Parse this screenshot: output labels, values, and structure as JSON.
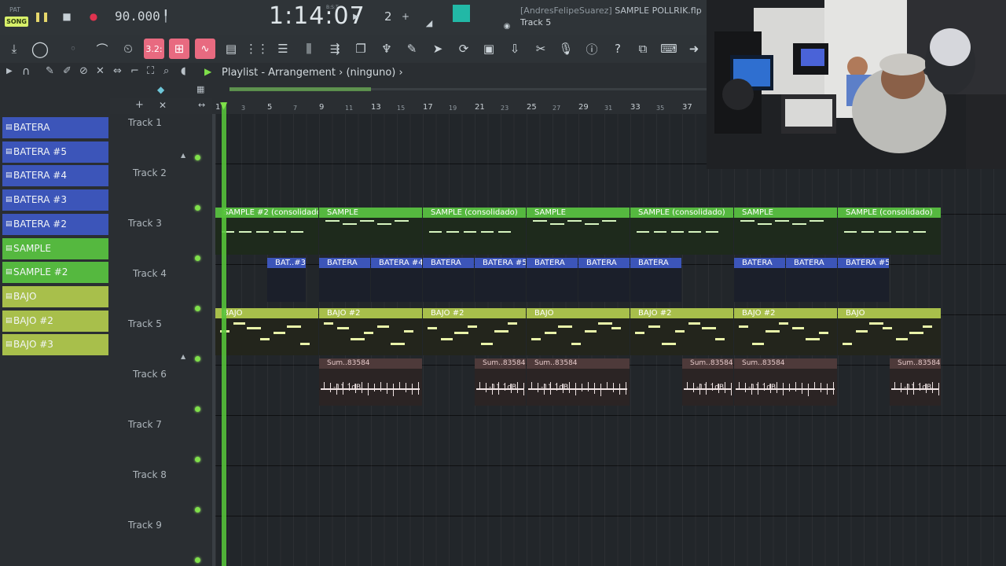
{
  "topbar": {
    "pat_label": "PAT",
    "song_label": "SONG",
    "tempo": "90.000",
    "time": "1:14:07",
    "bst_label": "B:S:T",
    "pattern_number": "2",
    "plus_label": "+",
    "file_user": "[AndresFelipeSuarez]",
    "file_name": "SAMPLE POLLRIK.flp",
    "current_track": "Track 5"
  },
  "toolbar": {
    "snap_value": "3.2:"
  },
  "playlist": {
    "title": "Playlist - Arrangement",
    "separator": "›",
    "pattern_selector": "(ninguno)"
  },
  "browser": {
    "patterns": [
      {
        "label": "BATERA",
        "color": "blue"
      },
      {
        "label": "BATERA #5",
        "color": "blue"
      },
      {
        "label": "BATERA #4",
        "color": "blue"
      },
      {
        "label": "BATERA #3",
        "color": "blue"
      },
      {
        "label": "BATERA #2",
        "color": "blue"
      },
      {
        "label": "SAMPLE",
        "color": "green"
      },
      {
        "label": "SAMPLE #2",
        "color": "green"
      },
      {
        "label": "BAJO",
        "color": "yellow"
      },
      {
        "label": "BAJO #2",
        "color": "yellow"
      },
      {
        "label": "BAJO #3",
        "color": "yellow"
      }
    ]
  },
  "tracks": [
    "Track 1",
    "Track 2",
    "Track 3",
    "Track 4",
    "Track 5",
    "Track 6",
    "Track 7",
    "Track 8",
    "Track 9"
  ],
  "ruler": {
    "major": [
      "1",
      "5",
      "9",
      "13",
      "17",
      "21",
      "25",
      "29",
      "33",
      "37"
    ],
    "minor": [
      "3",
      "7",
      "11",
      "15",
      "19",
      "23",
      "27",
      "31",
      "35"
    ]
  },
  "clips": {
    "track3": [
      "SAMPLE #2 (consolidado)",
      "SAMPLE",
      "SAMPLE (consolidado)",
      "SAMPLE",
      "SAMPLE (consolidado)",
      "SAMPLE",
      "SAMPLE (consolidado)"
    ],
    "track4": [
      "BAT..#3",
      "BATERA",
      "BATERA #4",
      "BATERA",
      "BATERA #5",
      "BATERA",
      "BATERA",
      "BATERA",
      "BATERA",
      "BATERA",
      "BATERA #5"
    ],
    "track5": [
      "BAJO",
      "BAJO #2",
      "BAJO #2",
      "BAJO",
      "BAJO #2",
      "BAJO #2",
      "BAJO"
    ],
    "track6": [
      "Sum..83584",
      "Sum..83584",
      "Sum..83584",
      "Sum..83584",
      "Sum..83584",
      "Sum..83584"
    ],
    "track6_db": "-11.1dB"
  },
  "colors": {
    "pattern_blue": "#3c55b9",
    "pattern_green": "#55b83f",
    "pattern_yellow": "#a8bf4b",
    "playhead": "#55c23a",
    "record": "#e0334f",
    "highlight_pink": "#e86a80"
  },
  "icons": [
    "play-icon",
    "stop-icon",
    "record-icon",
    "download-icon",
    "metronome-icon",
    "piano-roll-icon",
    "mixer-icon",
    "channel-rack-icon",
    "browser-icon",
    "plugin-icon",
    "render-icon",
    "help-icon",
    "info-icon",
    "arrow-right-icon",
    "magnet-icon",
    "pencil-icon",
    "brush-icon",
    "delete-icon",
    "mute-icon",
    "slip-icon",
    "select-icon",
    "zoom-icon",
    "speaker-icon"
  ]
}
